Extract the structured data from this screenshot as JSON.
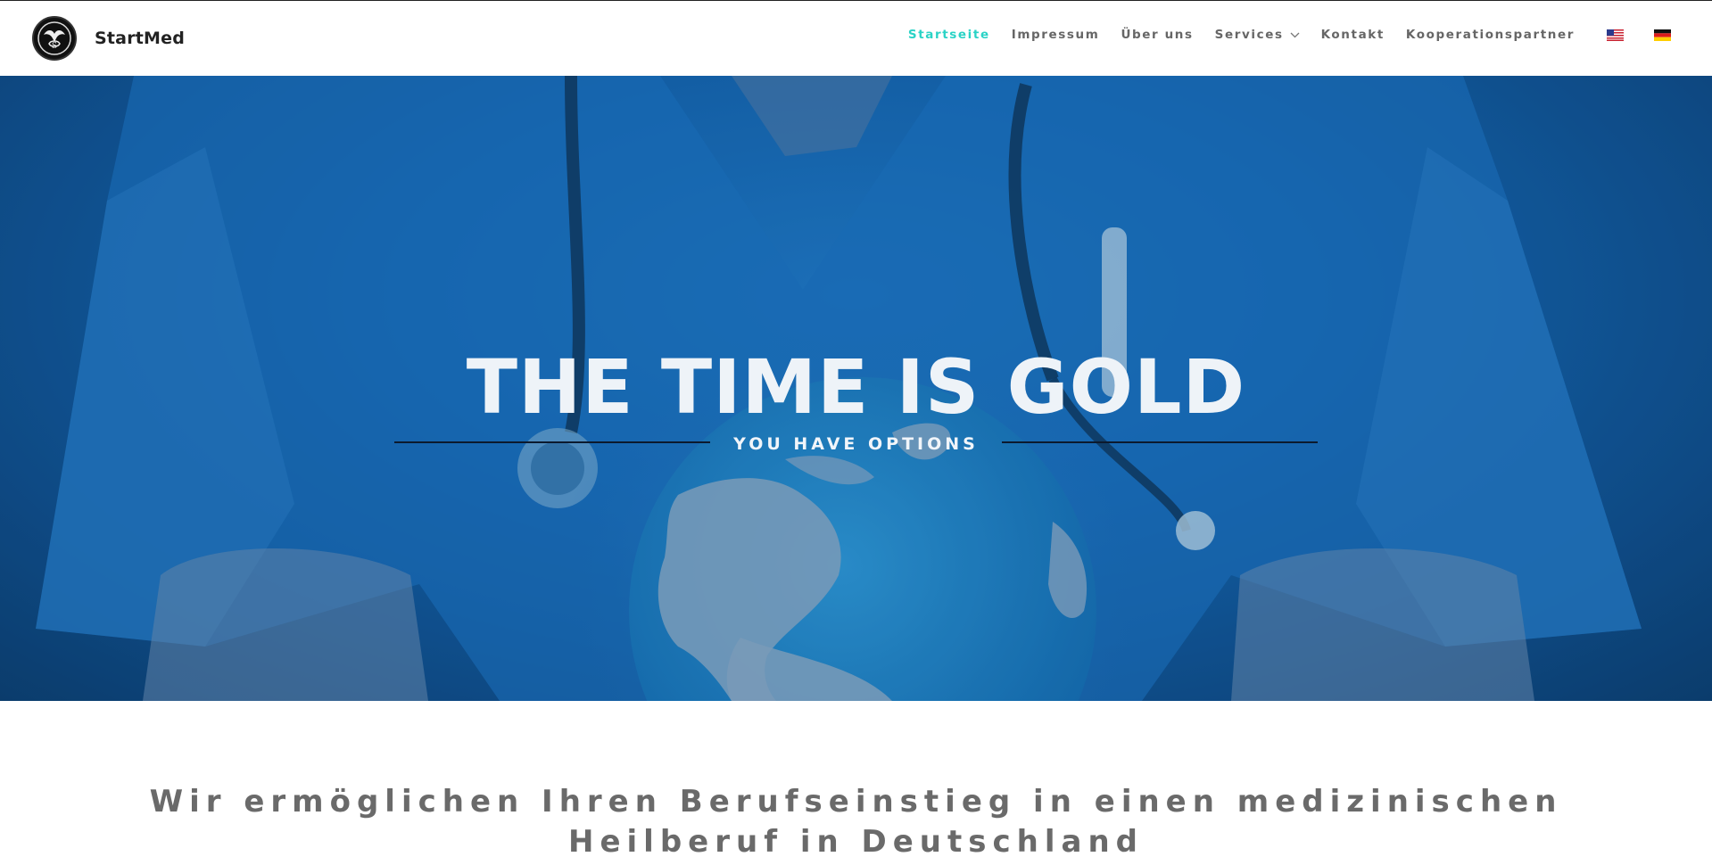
{
  "header": {
    "brand": "StartMed",
    "nav": [
      {
        "label": "Startseite",
        "active": true
      },
      {
        "label": "Impressum",
        "active": false
      },
      {
        "label": "Über uns",
        "active": false
      },
      {
        "label": "Services",
        "active": false,
        "has_dropdown": true
      },
      {
        "label": "Kontakt",
        "active": false
      },
      {
        "label": "Kooperationspartner",
        "active": false
      }
    ],
    "languages": [
      "flag-us-icon",
      "flag-de-icon"
    ],
    "accent_color": "#2ad3c6"
  },
  "hero": {
    "title": "THE TIME IS GOLD",
    "subtitle": "YOU HAVE OPTIONS"
  },
  "intro": {
    "tagline": "Wir ermöglichen Ihren Berufseinstieg in einen medizinischen Heilberuf in Deutschland"
  }
}
